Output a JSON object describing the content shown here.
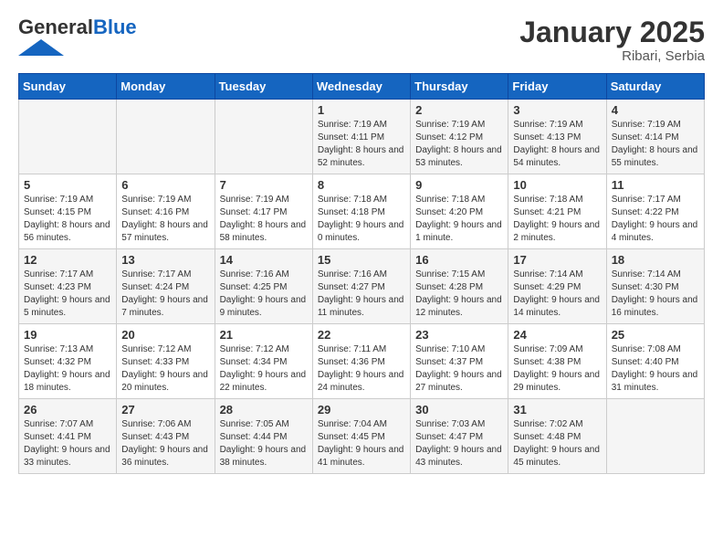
{
  "logo": {
    "text_general": "General",
    "text_blue": "Blue"
  },
  "header": {
    "month": "January 2025",
    "location": "Ribari, Serbia"
  },
  "weekdays": [
    "Sunday",
    "Monday",
    "Tuesday",
    "Wednesday",
    "Thursday",
    "Friday",
    "Saturday"
  ],
  "weeks": [
    [
      {
        "day": "",
        "info": ""
      },
      {
        "day": "",
        "info": ""
      },
      {
        "day": "",
        "info": ""
      },
      {
        "day": "1",
        "info": "Sunrise: 7:19 AM\nSunset: 4:11 PM\nDaylight: 8 hours and 52 minutes."
      },
      {
        "day": "2",
        "info": "Sunrise: 7:19 AM\nSunset: 4:12 PM\nDaylight: 8 hours and 53 minutes."
      },
      {
        "day": "3",
        "info": "Sunrise: 7:19 AM\nSunset: 4:13 PM\nDaylight: 8 hours and 54 minutes."
      },
      {
        "day": "4",
        "info": "Sunrise: 7:19 AM\nSunset: 4:14 PM\nDaylight: 8 hours and 55 minutes."
      }
    ],
    [
      {
        "day": "5",
        "info": "Sunrise: 7:19 AM\nSunset: 4:15 PM\nDaylight: 8 hours and 56 minutes."
      },
      {
        "day": "6",
        "info": "Sunrise: 7:19 AM\nSunset: 4:16 PM\nDaylight: 8 hours and 57 minutes."
      },
      {
        "day": "7",
        "info": "Sunrise: 7:19 AM\nSunset: 4:17 PM\nDaylight: 8 hours and 58 minutes."
      },
      {
        "day": "8",
        "info": "Sunrise: 7:18 AM\nSunset: 4:18 PM\nDaylight: 9 hours and 0 minutes."
      },
      {
        "day": "9",
        "info": "Sunrise: 7:18 AM\nSunset: 4:20 PM\nDaylight: 9 hours and 1 minute."
      },
      {
        "day": "10",
        "info": "Sunrise: 7:18 AM\nSunset: 4:21 PM\nDaylight: 9 hours and 2 minutes."
      },
      {
        "day": "11",
        "info": "Sunrise: 7:17 AM\nSunset: 4:22 PM\nDaylight: 9 hours and 4 minutes."
      }
    ],
    [
      {
        "day": "12",
        "info": "Sunrise: 7:17 AM\nSunset: 4:23 PM\nDaylight: 9 hours and 5 minutes."
      },
      {
        "day": "13",
        "info": "Sunrise: 7:17 AM\nSunset: 4:24 PM\nDaylight: 9 hours and 7 minutes."
      },
      {
        "day": "14",
        "info": "Sunrise: 7:16 AM\nSunset: 4:25 PM\nDaylight: 9 hours and 9 minutes."
      },
      {
        "day": "15",
        "info": "Sunrise: 7:16 AM\nSunset: 4:27 PM\nDaylight: 9 hours and 11 minutes."
      },
      {
        "day": "16",
        "info": "Sunrise: 7:15 AM\nSunset: 4:28 PM\nDaylight: 9 hours and 12 minutes."
      },
      {
        "day": "17",
        "info": "Sunrise: 7:14 AM\nSunset: 4:29 PM\nDaylight: 9 hours and 14 minutes."
      },
      {
        "day": "18",
        "info": "Sunrise: 7:14 AM\nSunset: 4:30 PM\nDaylight: 9 hours and 16 minutes."
      }
    ],
    [
      {
        "day": "19",
        "info": "Sunrise: 7:13 AM\nSunset: 4:32 PM\nDaylight: 9 hours and 18 minutes."
      },
      {
        "day": "20",
        "info": "Sunrise: 7:12 AM\nSunset: 4:33 PM\nDaylight: 9 hours and 20 minutes."
      },
      {
        "day": "21",
        "info": "Sunrise: 7:12 AM\nSunset: 4:34 PM\nDaylight: 9 hours and 22 minutes."
      },
      {
        "day": "22",
        "info": "Sunrise: 7:11 AM\nSunset: 4:36 PM\nDaylight: 9 hours and 24 minutes."
      },
      {
        "day": "23",
        "info": "Sunrise: 7:10 AM\nSunset: 4:37 PM\nDaylight: 9 hours and 27 minutes."
      },
      {
        "day": "24",
        "info": "Sunrise: 7:09 AM\nSunset: 4:38 PM\nDaylight: 9 hours and 29 minutes."
      },
      {
        "day": "25",
        "info": "Sunrise: 7:08 AM\nSunset: 4:40 PM\nDaylight: 9 hours and 31 minutes."
      }
    ],
    [
      {
        "day": "26",
        "info": "Sunrise: 7:07 AM\nSunset: 4:41 PM\nDaylight: 9 hours and 33 minutes."
      },
      {
        "day": "27",
        "info": "Sunrise: 7:06 AM\nSunset: 4:43 PM\nDaylight: 9 hours and 36 minutes."
      },
      {
        "day": "28",
        "info": "Sunrise: 7:05 AM\nSunset: 4:44 PM\nDaylight: 9 hours and 38 minutes."
      },
      {
        "day": "29",
        "info": "Sunrise: 7:04 AM\nSunset: 4:45 PM\nDaylight: 9 hours and 41 minutes."
      },
      {
        "day": "30",
        "info": "Sunrise: 7:03 AM\nSunset: 4:47 PM\nDaylight: 9 hours and 43 minutes."
      },
      {
        "day": "31",
        "info": "Sunrise: 7:02 AM\nSunset: 4:48 PM\nDaylight: 9 hours and 45 minutes."
      },
      {
        "day": "",
        "info": ""
      }
    ]
  ]
}
